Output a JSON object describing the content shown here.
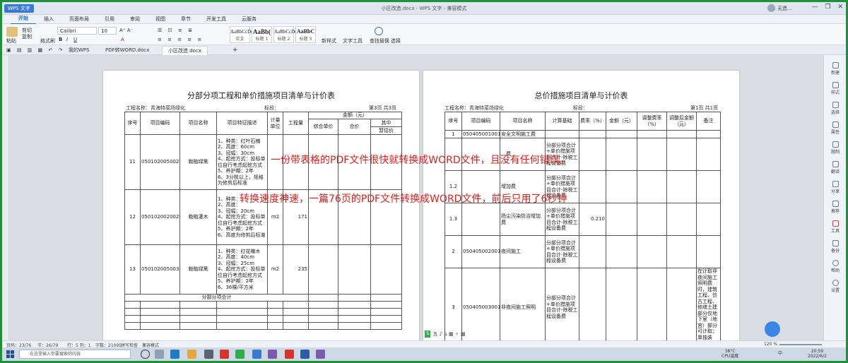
{
  "window": {
    "app_badge": "WPS 文字",
    "title": "小区改造.docx - WPS 文字 - 兼容模式",
    "user": "无造…",
    "controls": [
      "—",
      "❐",
      "✕"
    ]
  },
  "menu": {
    "tabs": [
      "开始",
      "插入",
      "页面布局",
      "引用",
      "审阅",
      "视图",
      "章节",
      "开发工具",
      "云服务"
    ],
    "active_index": 0
  },
  "ribbon": {
    "paste": "粘贴",
    "cut": "剪切",
    "copy": "复制",
    "format_painter": "格式刷",
    "font_name": "Calibri",
    "font_size": "10",
    "styles": [
      {
        "sample": "AaBbCcDd",
        "label": "正文"
      },
      {
        "sample": "AaBb(",
        "label": "标题 1"
      },
      {
        "sample": "AaBbCcDd",
        "label": "标题 2"
      },
      {
        "sample": "AaBbC",
        "label": "标题 3"
      }
    ],
    "new_style": "新样式",
    "text_tools": "文字工具",
    "find_replace": "查找替换",
    "select": "选择"
  },
  "doc_tabs": [
    "我的WPS",
    "PDF转WORD.docx",
    "小区改造.docx"
  ],
  "doc_tabs_active": 2,
  "page_left": {
    "title": "分部分项工程和单价措施项目清单与计价表",
    "project": "工程名称：青海特菜场绿化",
    "section": "标段：",
    "page_no": "第3页  共3页",
    "headers": {
      "seq": "序号",
      "code": "项目编码",
      "name": "项目名称",
      "feature": "项目特征描述",
      "unit": "计量单位",
      "qty": "工程量",
      "amount": "金额（元）",
      "unit_price": "综合单价",
      "total": "合价",
      "of_which": "其中",
      "est": "暂估价"
    },
    "rows": [
      {
        "seq": "11",
        "code": "050102005002",
        "name": "栽植绿篱",
        "feature": "1、种类：红叶石楠\n2、高度：60cm\n3、冠幅：30cm\n4、起挖方式：投标单位自行考虑起挖方式\n5、养护期：2年\n6、3分枝以上，规格为修剪后标准",
        "unit": "",
        "qty": ""
      },
      {
        "seq": "12",
        "code": "050102002002",
        "name": "栽植灌木",
        "feature": "1、种类：\n2、高度：\n3、冠幅：20cm\n4、起挖方式：投标单位自行考虑起挖方式\n5、养护期：2年\n6、高度为修剪后标准",
        "unit": "m2",
        "qty": "171"
      },
      {
        "seq": "13",
        "code": "050102005003",
        "name": "栽植绿篱",
        "feature": "1、种类：红花檵木\n2、高度：40cm\n3、冠幅：25cm\n4、起挖方式：投标单位自行考虑起挖方式\n5、养护期：2年\n6、36棵/平方米",
        "unit": "m2",
        "qty": "235"
      }
    ],
    "subtotal": "分部分项合计"
  },
  "page_right": {
    "title": "总价措施项目清单与计价表",
    "project": "工程名称：青海特菜场绿化",
    "section": "标段：",
    "page_no": "第1页  共1页",
    "headers": {
      "seq": "序号",
      "code": "项目编码",
      "name": "项目名称",
      "basis": "计算基础",
      "rate": "费率（%）",
      "amount": "金额（元）",
      "adj_rate": "调整费率（%）",
      "adj_amount": "调整后金额（元）",
      "remark": "备注"
    },
    "rows": [
      {
        "seq": "1",
        "code": "050405001001",
        "name": "安全文明施工费",
        "basis": "",
        "rate": "",
        "remark": ""
      },
      {
        "seq": "",
        "code": "",
        "name": "…费",
        "basis": "分部分项合计+单价措施项目合计-除税工程设备费",
        "rate": "",
        "remark": ""
      },
      {
        "seq": "1.2",
        "code": "",
        "name": "增加费",
        "basis": "分部分项合计+单价措施项目合计-除税工程设备费",
        "rate": "",
        "remark": ""
      },
      {
        "seq": "1.3",
        "code": "",
        "name": "扬尘污染防治增加费",
        "basis": "分部分项合计+单价措施项目合计-除税工程设备费",
        "rate": "0.210",
        "remark": ""
      },
      {
        "seq": "2",
        "code": "050405002001",
        "name": "夜间施工",
        "basis": "分部分项合计+单价措施项目合计-除税工程设备费",
        "rate": "",
        "remark": ""
      },
      {
        "seq": "3",
        "code": "050405003001",
        "name": "非夜间施工照明",
        "basis": "分部分项合计+单价措施项目合计-除税工程设备费",
        "rate": "",
        "remark": "在计取非夜间施工照明费时，建筑工程、仿古工程、修缮土建部分仅地下室（地宫）部分可计取；单独装饰、安…"
      }
    ]
  },
  "overlay": {
    "line1": "一份带表格的PDF文件很快就转换成WORD文件，且没有任何错误。",
    "line2": "转换速度神速，一篇76页的PDF文件转换成WORD文件，前后只用了6秒钟"
  },
  "right_panel": [
    "新建",
    "样式",
    "选择",
    "属性",
    "限制",
    "翻译",
    "分享",
    "推荐",
    "工具",
    "备份",
    "帮助",
    "设置"
  ],
  "status": {
    "page": "页码：23/76",
    "section": "节：26/79",
    "row": "行：5  列：1",
    "words": "字数：21095",
    "spell": "拼写检查",
    "mode": "兼容模式",
    "zoom": "120 %"
  },
  "taskbar": {
    "search_placeholder": "在这里输入你要搜索的内容",
    "temperature": "38°C",
    "cpu": "CPU温度",
    "time": "20:59",
    "date": "2022/6/2",
    "ime": "中"
  }
}
